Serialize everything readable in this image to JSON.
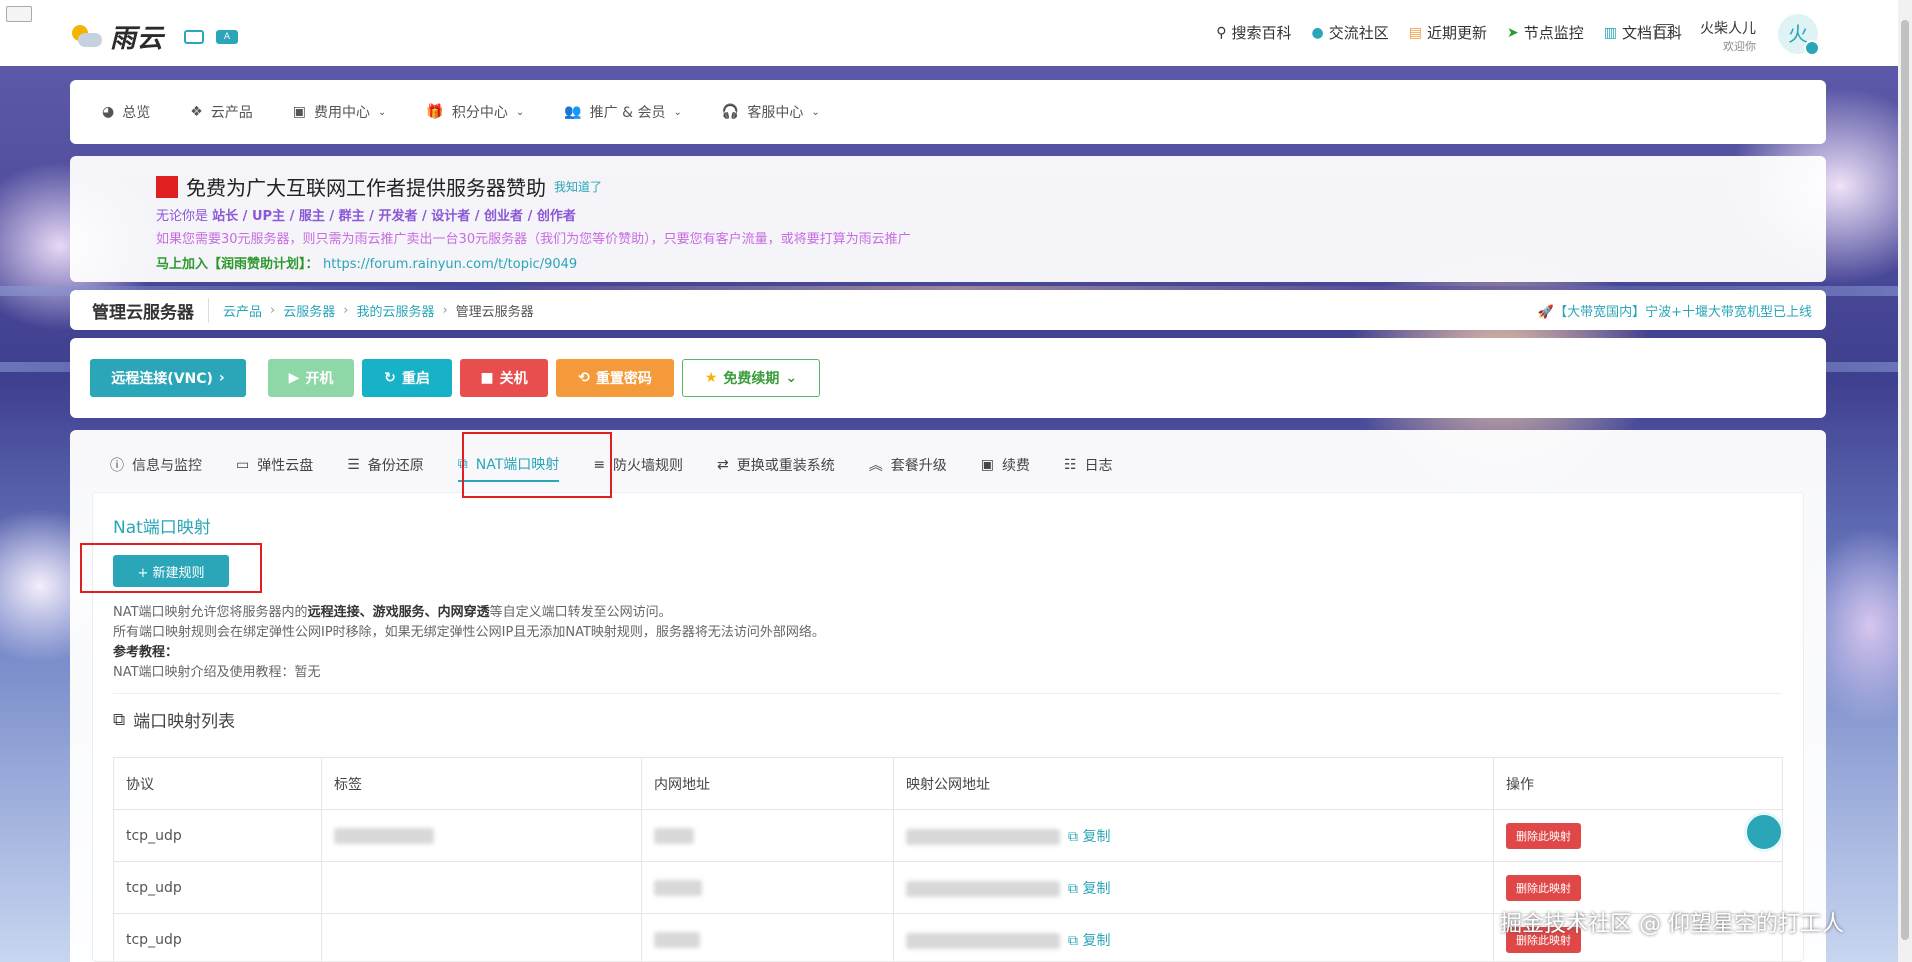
{
  "brand": {
    "name": "雨云",
    "badge": "A"
  },
  "topnav": [
    {
      "icon": "search-icon",
      "label": "搜索百科"
    },
    {
      "icon": "community-icon",
      "label": "交流社区"
    },
    {
      "icon": "update-icon",
      "label": "近期更新"
    },
    {
      "icon": "monitor-icon",
      "label": "节点监控"
    },
    {
      "icon": "book-icon",
      "label": "文档百科"
    }
  ],
  "user": {
    "name": "火柴人儿",
    "welcome": "欢迎你",
    "avatar_char": "火"
  },
  "menu": [
    {
      "label": "总览"
    },
    {
      "label": "云产品"
    },
    {
      "label": "费用中心"
    },
    {
      "label": "积分中心"
    },
    {
      "label": "推广 & 会员"
    },
    {
      "label": "客服中心"
    }
  ],
  "notice": {
    "title": "免费为广大互联网工作者提供服务器赞助",
    "dismiss": "我知道了",
    "line1_prefix": "无论你是",
    "line1_roles": "站长 / UP主 / 服主 / 群主 / 开发者 / 设计者 / 创业者 / 创作者",
    "line2": "如果您需要30元服务器，则只需为雨云推广卖出一台30元服务器（我们为您等价赞助），只要您有客户流量，或将要打算为雨云推广",
    "line3_label": "马上加入【润雨赞助计划】：",
    "line3_link": "https://forum.rainyun.com/t/topic/9049"
  },
  "breadcrumb": {
    "title": "管理云服务器",
    "items": [
      "云产品",
      "云服务器",
      "我的云服务器"
    ],
    "current": "管理云服务器",
    "news": "🚀【大带宽国内】宁波+十堰大带宽机型已上线"
  },
  "actions": {
    "vnc": "远程连接(VNC)",
    "start": "开机",
    "restart": "重启",
    "shutdown": "关机",
    "reset_pw": "重置密码",
    "free_renew": "免费续期"
  },
  "tabs": [
    "信息与监控",
    "弹性云盘",
    "备份还原",
    "NAT端口映射",
    "防火墙规则",
    "更换或重装系统",
    "套餐升级",
    "续费",
    "日志"
  ],
  "active_tab": "NAT端口映射",
  "panel": {
    "title": "Nat端口映射",
    "new_rule": "+ 新建规则",
    "desc1_pre": "NAT端口映射允许您将服务器内的",
    "desc1_bold": "远程连接、游戏服务、内网穿透",
    "desc1_post": "等自定义端口转发至公网访问。",
    "desc2": "所有端口映射规则会在绑定弹性公网IP时移除，如果无绑定弹性公网IP且无添加NAT映射规则，服务器将无法访问外部网络。",
    "desc3": "参考教程：",
    "desc4": "NAT端口映射介绍及使用教程：暂无",
    "list_title": "端口映射列表"
  },
  "table": {
    "headers": [
      "协议",
      "标签",
      "内网地址",
      "映射公网地址",
      "操作"
    ],
    "rows": [
      {
        "protocol": "tcp_udp",
        "copy": "复制",
        "delete": "删除此映射"
      },
      {
        "protocol": "tcp_udp",
        "copy": "复制",
        "delete": "删除此映射"
      },
      {
        "protocol": "tcp_udp",
        "copy": "复制",
        "delete": "删除此映射"
      }
    ]
  },
  "watermark": "掘金技术社区 @ 仰望星空的打工人",
  "colors": {
    "accent": "#2aa6b8",
    "danger": "#e04848",
    "warn": "#f59a3a",
    "highlight_box": "#e02020"
  }
}
